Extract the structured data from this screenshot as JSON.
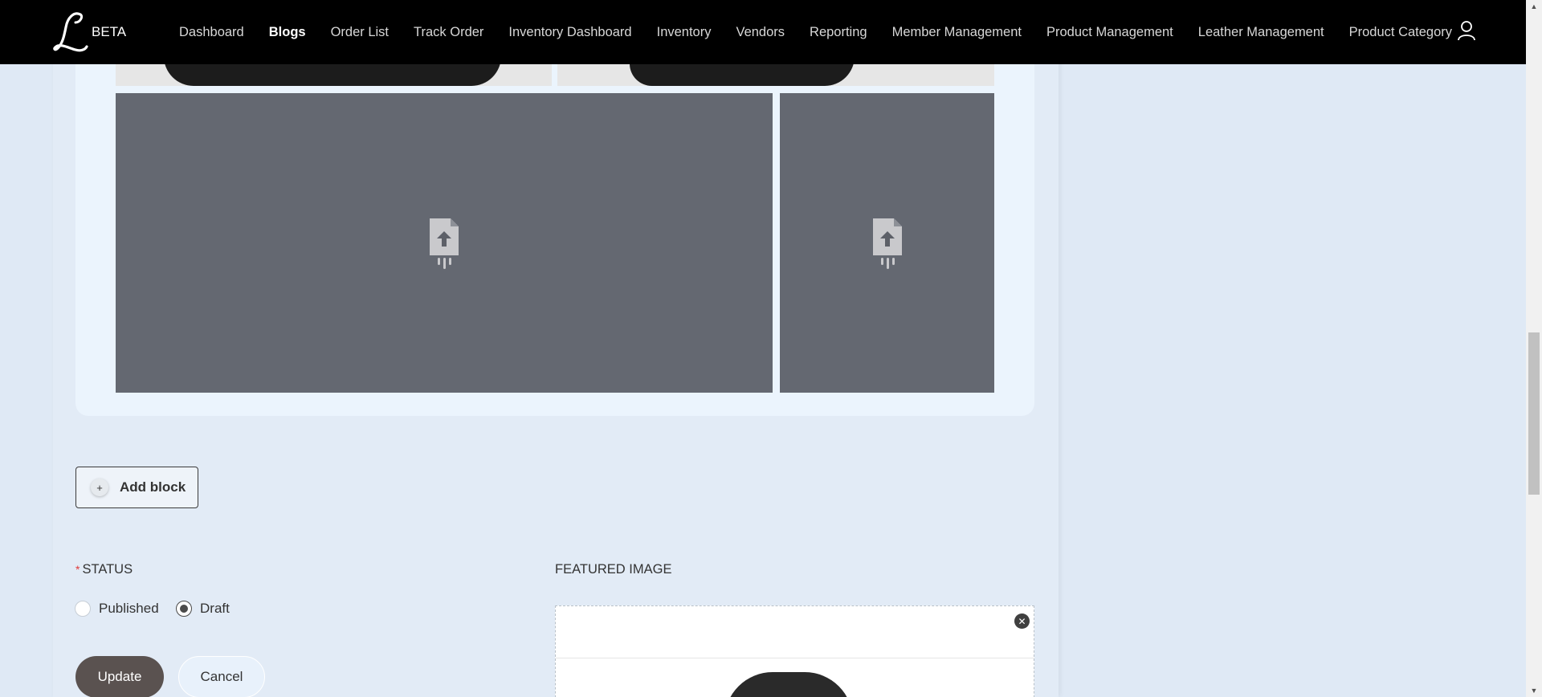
{
  "header": {
    "brand": "BETA",
    "nav": [
      {
        "label": "Dashboard",
        "active": false
      },
      {
        "label": "Blogs",
        "active": true
      },
      {
        "label": "Order List",
        "active": false
      },
      {
        "label": "Track Order",
        "active": false
      },
      {
        "label": "Inventory Dashboard",
        "active": false
      },
      {
        "label": "Inventory",
        "active": false
      },
      {
        "label": "Vendors",
        "active": false
      },
      {
        "label": "Reporting",
        "active": false
      },
      {
        "label": "Member Management",
        "active": false
      },
      {
        "label": "Product Management",
        "active": false
      },
      {
        "label": "Leather Management",
        "active": false
      },
      {
        "label": "Product Category",
        "active": false
      }
    ],
    "user_icon": "user-icon"
  },
  "editor": {
    "add_block_label": "Add block",
    "add_block_icon": "plus-icon",
    "placeholder_icon": "file-upload-icon"
  },
  "form": {
    "status_label": "STATUS",
    "required_mark": "*",
    "status_options": [
      {
        "label": "Published",
        "checked": false
      },
      {
        "label": "Draft",
        "checked": true
      }
    ],
    "featured_image_label": "FEATURED IMAGE",
    "update_label": "Update",
    "cancel_label": "Cancel",
    "remove_icon": "close-icon"
  },
  "colors": {
    "nav_bg": "#000000",
    "page_bg": "#dfe9f5",
    "placeholder_bg": "#646871",
    "primary_button": "#5a5250"
  }
}
